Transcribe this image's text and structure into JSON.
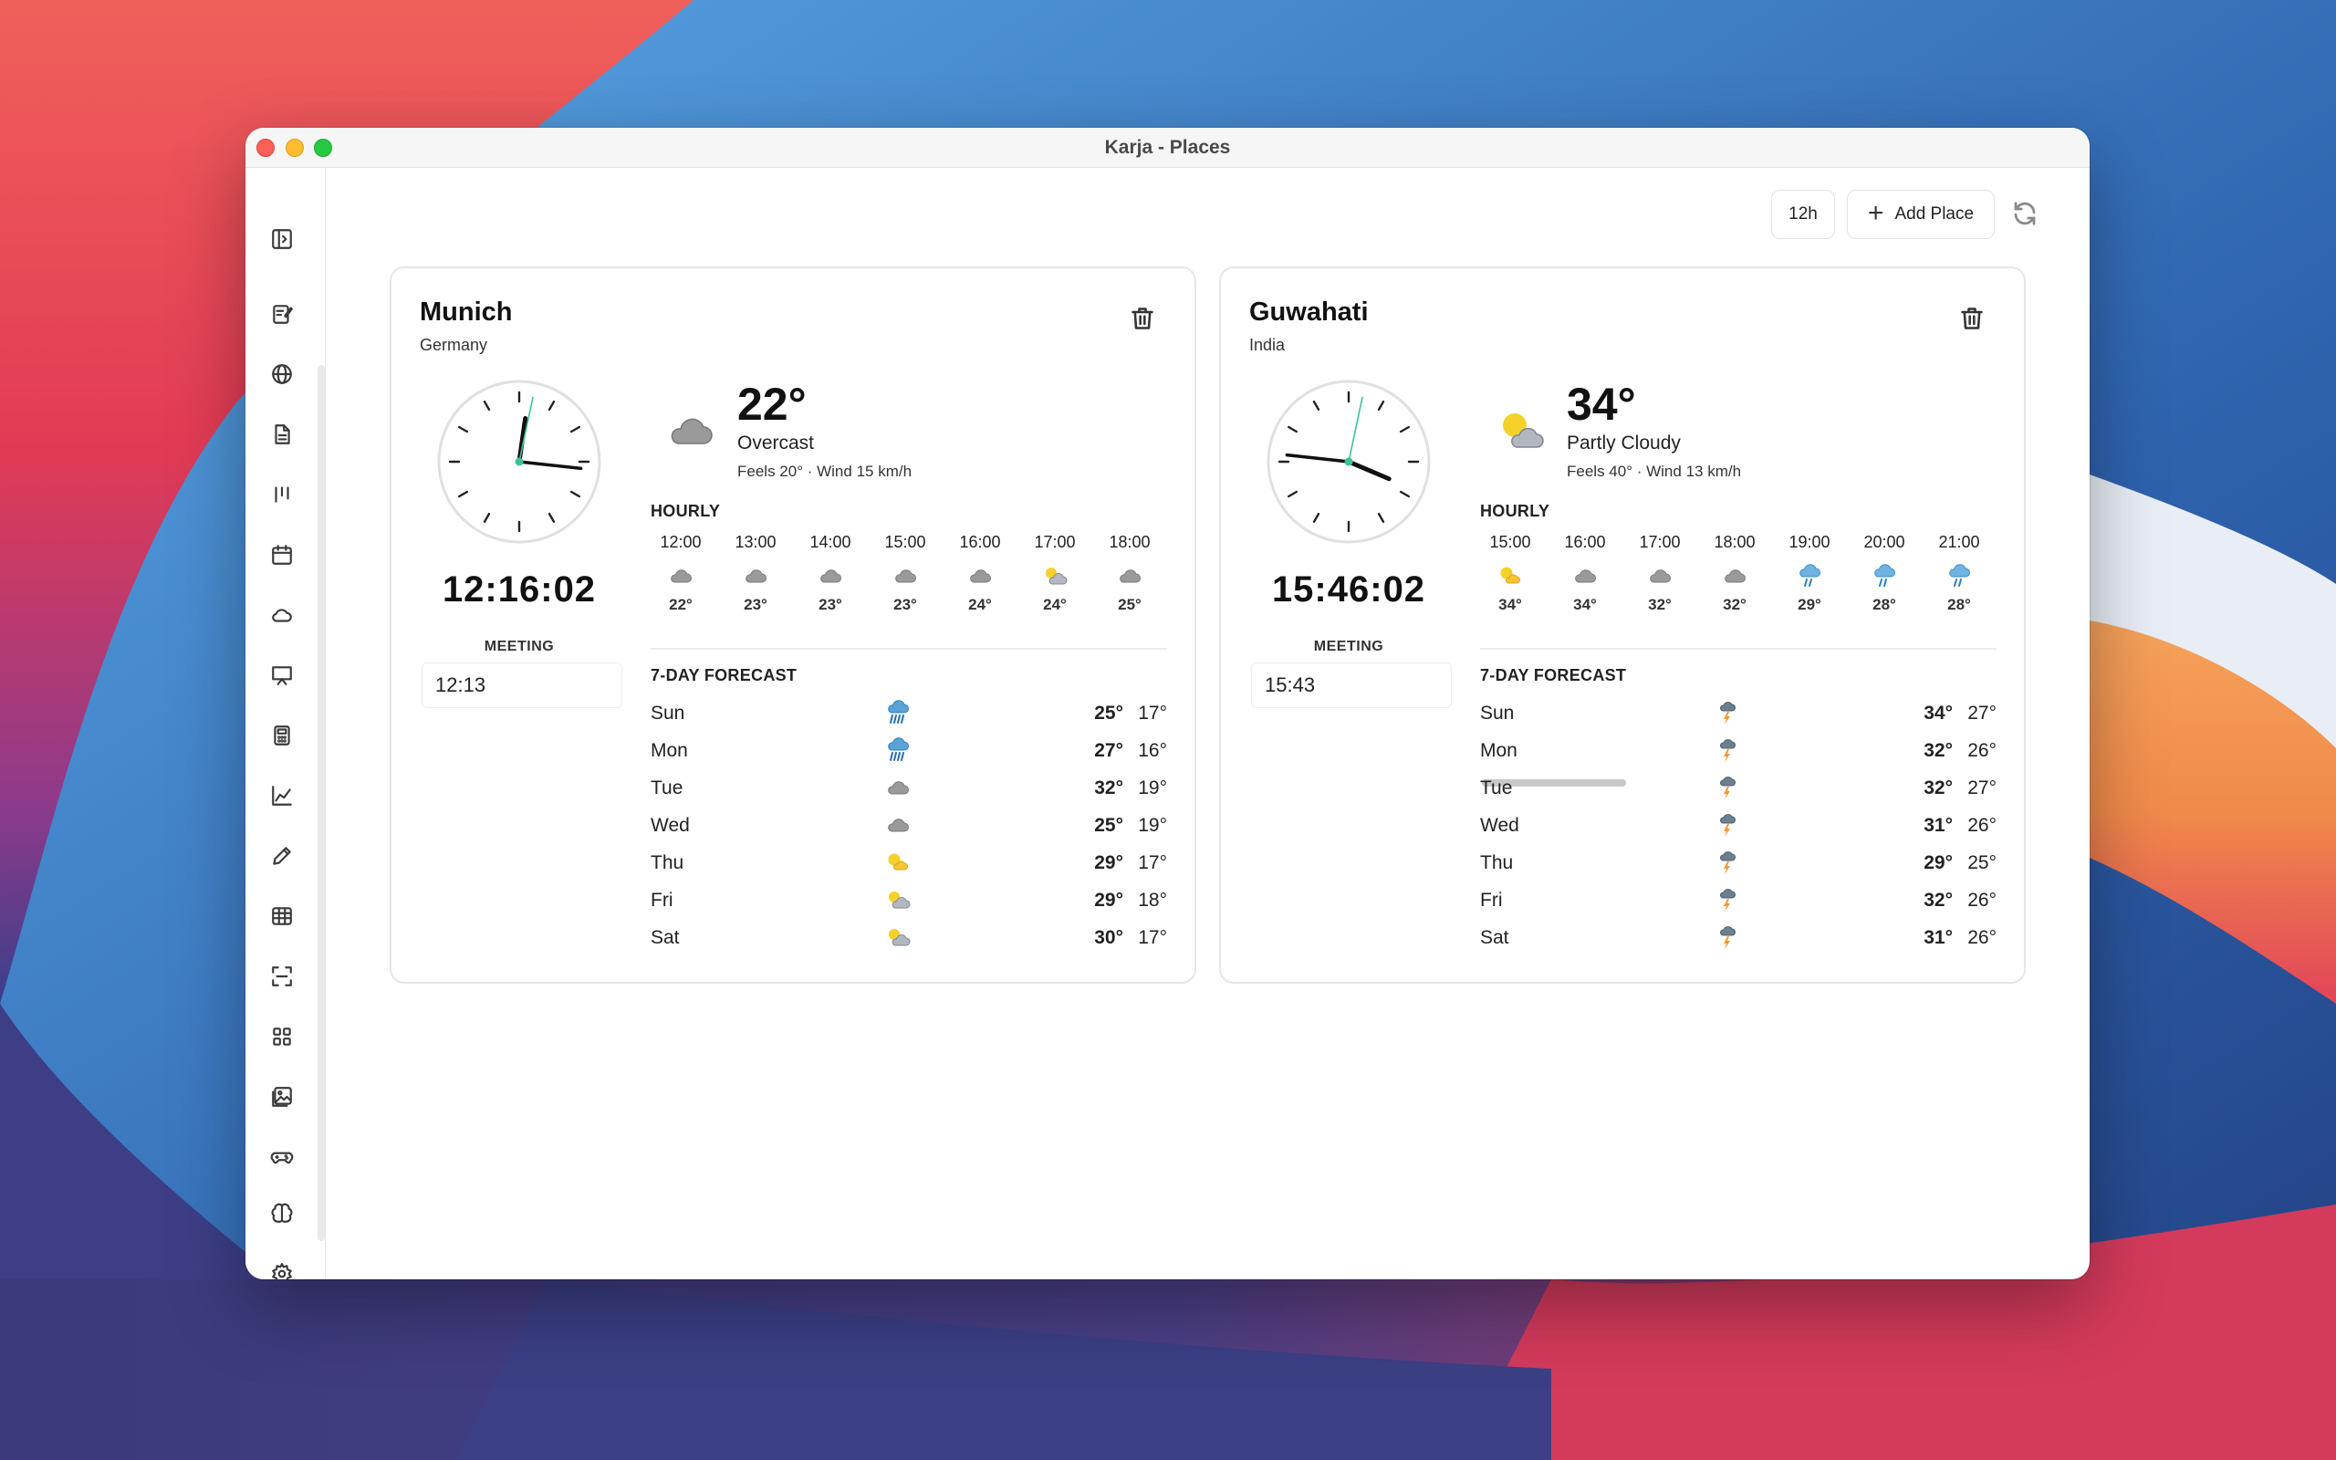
{
  "window": {
    "title": "Karja - Places"
  },
  "toolbar": {
    "time_format_label": "12h",
    "add_place_label": "Add Place"
  },
  "sidebar": {
    "items": [
      "toggle-sidebar-icon",
      "notes-icon",
      "globe-icon",
      "document-icon",
      "kanban-icon",
      "calendar-icon",
      "cloud-icon",
      "presentation-icon",
      "calculator-icon",
      "chart-icon",
      "pencil-icon",
      "table-icon",
      "scan-icon",
      "grid-icon",
      "gallery-icon",
      "gamepad-icon",
      "brain-icon",
      "settings-icon"
    ]
  },
  "places": [
    {
      "city": "Munich",
      "country": "Germany",
      "digital_time": "12:16:02",
      "meeting_label": "MEETING",
      "meeting_value": "12:13",
      "current": {
        "temp": "22°",
        "condition": "Overcast",
        "feels": "Feels 20° · Wind 15 km/h",
        "icon": "cloud-icon"
      },
      "hourly_label": "HOURLY",
      "hourly": [
        {
          "time": "12:00",
          "temp": "22°",
          "icon": "cloud"
        },
        {
          "time": "13:00",
          "temp": "23°",
          "icon": "cloud"
        },
        {
          "time": "14:00",
          "temp": "23°",
          "icon": "cloud"
        },
        {
          "time": "15:00",
          "temp": "23°",
          "icon": "cloud"
        },
        {
          "time": "16:00",
          "temp": "24°",
          "icon": "cloud"
        },
        {
          "time": "17:00",
          "temp": "24°",
          "icon": "partly"
        },
        {
          "time": "18:00",
          "temp": "25°",
          "icon": "cloud"
        }
      ],
      "forecast_label": "7-DAY FORECAST",
      "forecast": [
        {
          "day": "Sun",
          "hi": "25°",
          "lo": "17°",
          "icon": "rain-heavy"
        },
        {
          "day": "Mon",
          "hi": "27°",
          "lo": "16°",
          "icon": "rain-heavy"
        },
        {
          "day": "Tue",
          "hi": "32°",
          "lo": "19°",
          "icon": "cloud"
        },
        {
          "day": "Wed",
          "hi": "25°",
          "lo": "19°",
          "icon": "cloud"
        },
        {
          "day": "Thu",
          "hi": "29°",
          "lo": "17°",
          "icon": "sun-cloud"
        },
        {
          "day": "Fri",
          "hi": "29°",
          "lo": "18°",
          "icon": "partly"
        },
        {
          "day": "Sat",
          "hi": "30°",
          "lo": "17°",
          "icon": "partly"
        }
      ]
    },
    {
      "city": "Guwahati",
      "country": "India",
      "digital_time": "15:46:02",
      "meeting_label": "MEETING",
      "meeting_value": "15:43",
      "current": {
        "temp": "34°",
        "condition": "Partly Cloudy",
        "feels": "Feels 40° · Wind 13 km/h",
        "icon": "partly-cloudy-icon"
      },
      "hourly_label": "HOURLY",
      "hourly": [
        {
          "time": "15:00",
          "temp": "34°",
          "icon": "sun-cloud"
        },
        {
          "time": "16:00",
          "temp": "34°",
          "icon": "cloud"
        },
        {
          "time": "17:00",
          "temp": "32°",
          "icon": "cloud"
        },
        {
          "time": "18:00",
          "temp": "32°",
          "icon": "cloud"
        },
        {
          "time": "19:00",
          "temp": "29°",
          "icon": "rain"
        },
        {
          "time": "20:00",
          "temp": "28°",
          "icon": "rain"
        },
        {
          "time": "21:00",
          "temp": "28°",
          "icon": "rain"
        }
      ],
      "forecast_label": "7-DAY FORECAST",
      "forecast": [
        {
          "day": "Sun",
          "hi": "34°",
          "lo": "27°",
          "icon": "thunder"
        },
        {
          "day": "Mon",
          "hi": "32°",
          "lo": "26°",
          "icon": "thunder"
        },
        {
          "day": "Tue",
          "hi": "32°",
          "lo": "27°",
          "icon": "thunder"
        },
        {
          "day": "Wed",
          "hi": "31°",
          "lo": "26°",
          "icon": "thunder"
        },
        {
          "day": "Thu",
          "hi": "29°",
          "lo": "25°",
          "icon": "thunder"
        },
        {
          "day": "Fri",
          "hi": "32°",
          "lo": "26°",
          "icon": "thunder"
        },
        {
          "day": "Sat",
          "hi": "31°",
          "lo": "26°",
          "icon": "thunder"
        }
      ]
    }
  ]
}
